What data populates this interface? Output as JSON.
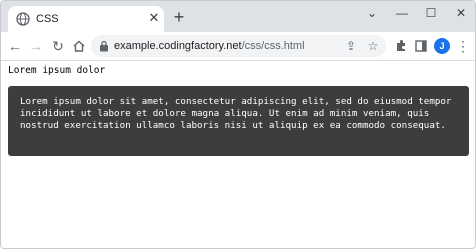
{
  "browser": {
    "tab_title": "CSS",
    "url_host": "example.codingfactory.net",
    "url_path": "/css/css.html",
    "profile_initial": "J"
  },
  "content": {
    "heading": "Lorem ipsum dolor",
    "paragraph": "Lorem ipsum dolor sit amet, consectetur adipiscing elit, sed do eiusmod tempor incididunt ut labore et dolore magna aliqua. Ut enim ad minim veniam, quis nostrud exercitation ullamco laboris nisi ut aliquip ex ea commodo consequat."
  },
  "colors": {
    "accent": "#1a73e8",
    "code_bg": "#3d3d3d"
  }
}
